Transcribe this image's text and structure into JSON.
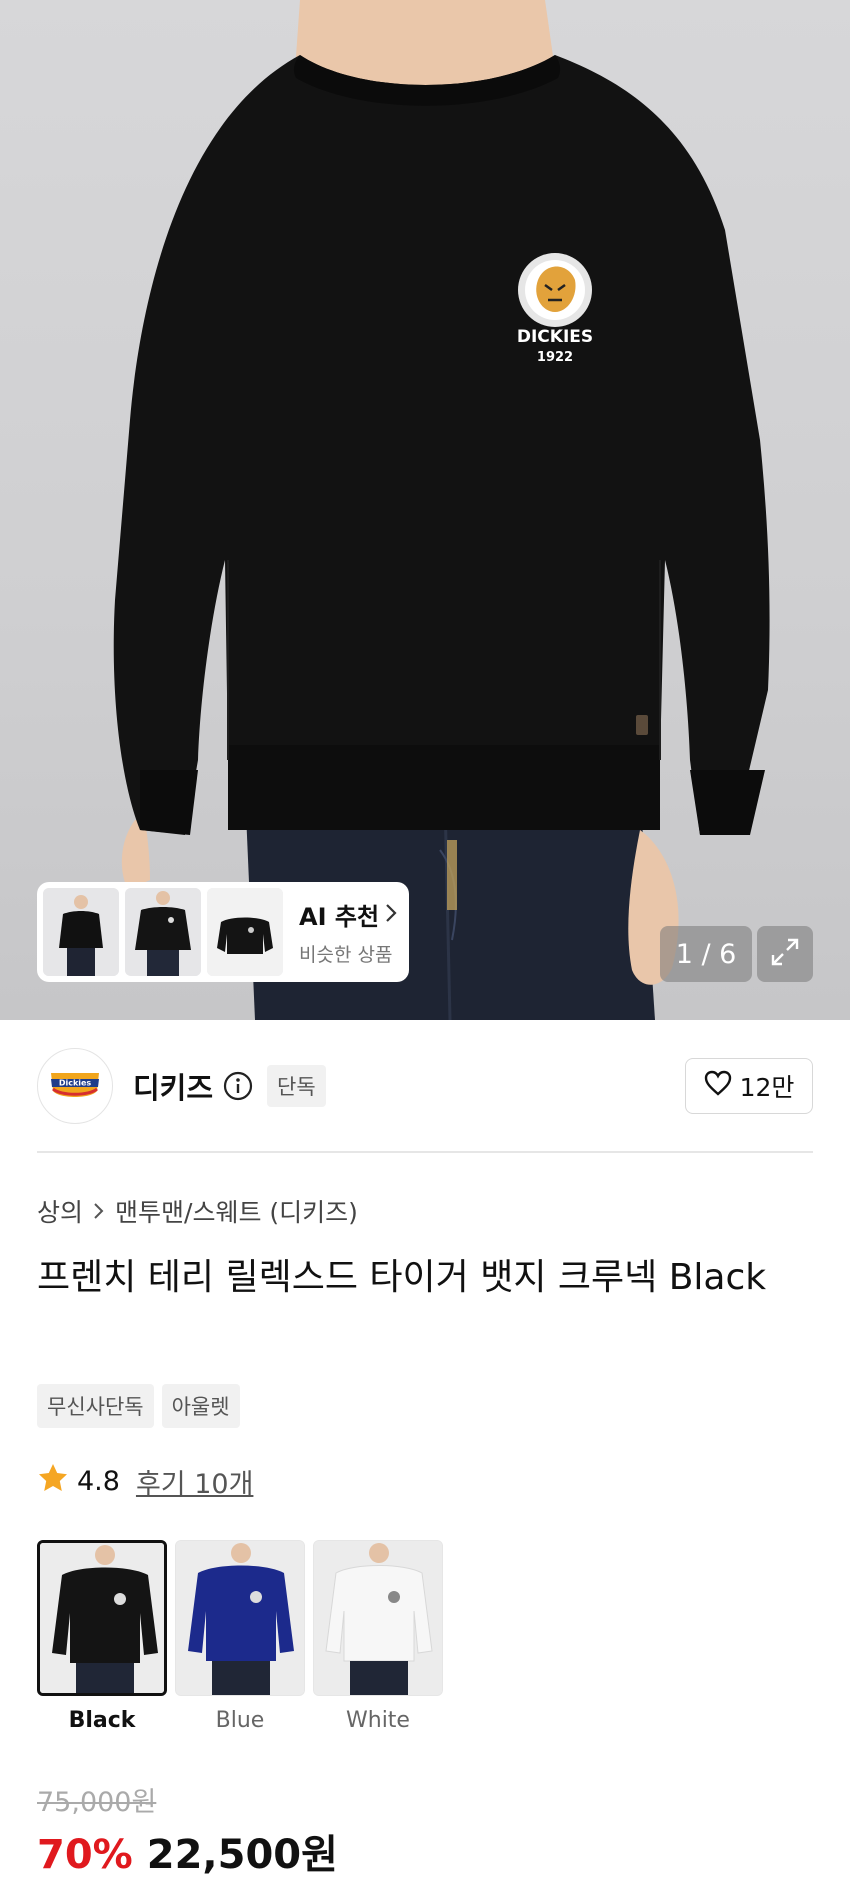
{
  "hero": {
    "product_logo_text": "DICKIES",
    "product_logo_year": "1922",
    "ai_card": {
      "title": "AI 추천",
      "subtitle": "비슷한 상품"
    },
    "image_counter": "1 / 6"
  },
  "brand": {
    "name": "디키즈",
    "logo_text": "Dickies",
    "badge": "단독",
    "like_count": "12만"
  },
  "product": {
    "breadcrumb": [
      "상의",
      "맨투맨/스웨트 (디키즈)"
    ],
    "title": "프렌치 테리 릴렉스드 타이거 뱃지 크루넥 Black",
    "tags": [
      "무신사단독",
      "아울렛"
    ],
    "rating": "4.8",
    "review_link": "후기 10개",
    "colors": [
      {
        "label": "Black",
        "selected": true,
        "swatch": "#141414"
      },
      {
        "label": "Blue",
        "selected": false,
        "swatch": "#1c2a8c"
      },
      {
        "label": "White",
        "selected": false,
        "swatch": "#eeeeee"
      }
    ],
    "original_price": "75,000원",
    "discount": "70%",
    "price": "22,500원"
  },
  "colors": {
    "accent_red": "#e0191e",
    "star": "#f5a623"
  }
}
